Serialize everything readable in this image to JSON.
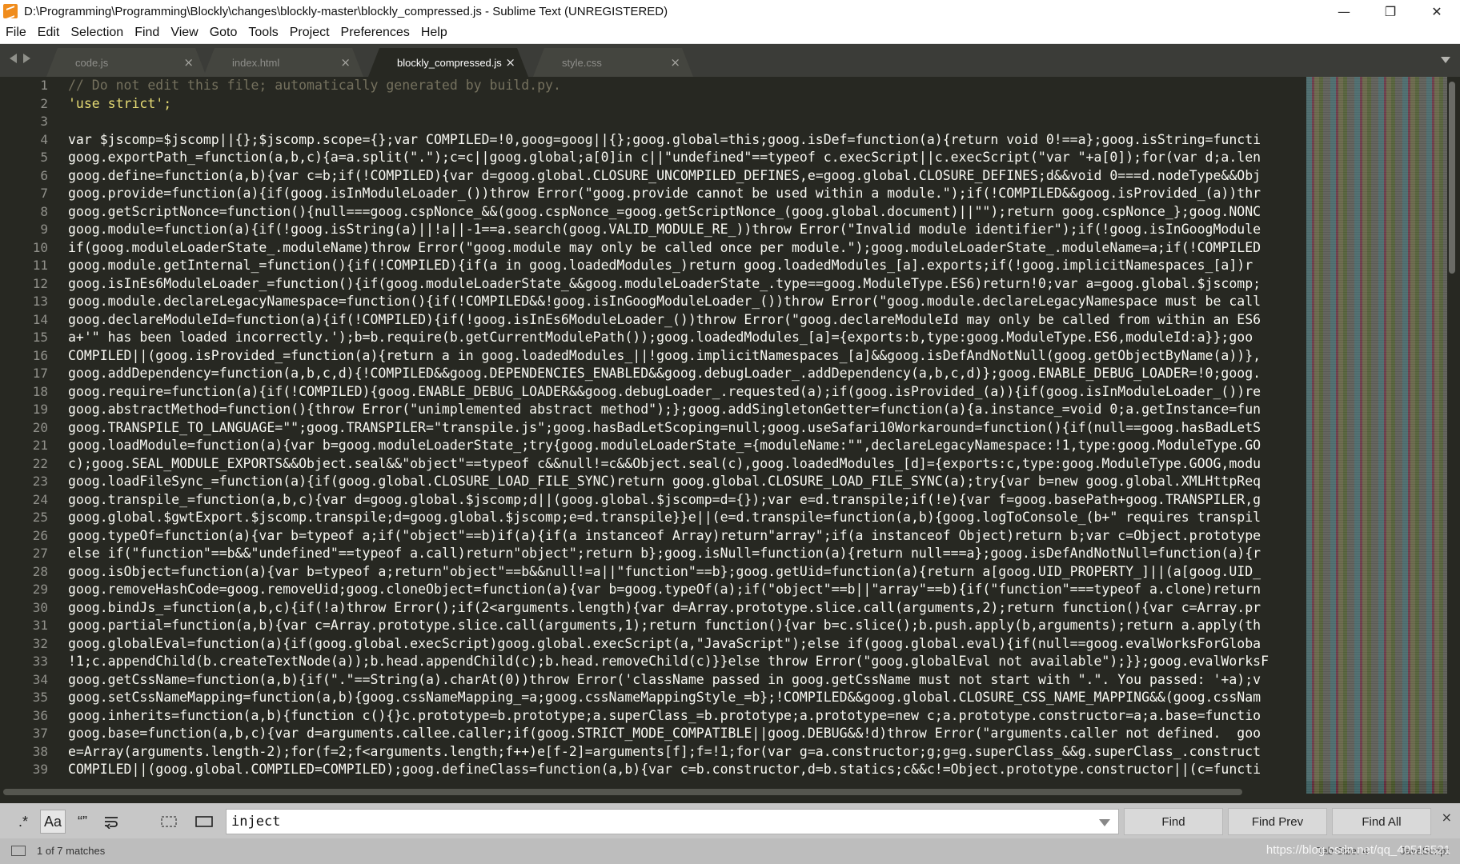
{
  "window": {
    "title": "D:\\Programming\\Programming\\Blockly\\changes\\blockly-master\\blockly_compressed.js - Sublime Text (UNREGISTERED)",
    "minimize_glyph": "—",
    "maximize_glyph": "❐",
    "close_glyph": "✕"
  },
  "menu": [
    "File",
    "Edit",
    "Selection",
    "Find",
    "View",
    "Goto",
    "Tools",
    "Project",
    "Preferences",
    "Help"
  ],
  "tabs": [
    {
      "label": "code.js",
      "active": false
    },
    {
      "label": "index.html",
      "active": false
    },
    {
      "label": "blockly_compressed.js",
      "active": true
    },
    {
      "label": "style.css",
      "active": false
    }
  ],
  "tab_close_glyph": "×",
  "editor": {
    "line_numbers": [
      "1",
      "2",
      "3",
      "4",
      "5",
      "6",
      "7",
      "8",
      "9",
      "10",
      "11",
      "12",
      "13",
      "14",
      "15",
      "16",
      "17",
      "18",
      "19",
      "20",
      "21",
      "22",
      "23",
      "24",
      "25",
      "26",
      "27",
      "28",
      "29",
      "30",
      "31",
      "32",
      "33",
      "34",
      "35",
      "36",
      "37",
      "38",
      "39"
    ],
    "lines": [
      "// Do not edit this file; automatically generated by build.py.",
      "'use strict';",
      "",
      "var $jscomp=$jscomp||{};$jscomp.scope={};var COMPILED=!0,goog=goog||{};goog.global=this;goog.isDef=function(a){return void 0!==a};goog.isString=functi",
      "goog.exportPath_=function(a,b,c){a=a.split(\".\");c=c||goog.global;a[0]in c||\"undefined\"==typeof c.execScript||c.execScript(\"var \"+a[0]);for(var d;a.len",
      "goog.define=function(a,b){var c=b;if(!COMPILED){var d=goog.global.CLOSURE_UNCOMPILED_DEFINES,e=goog.global.CLOSURE_DEFINES;d&&void 0===d.nodeType&&Obj",
      "goog.provide=function(a){if(goog.isInModuleLoader_())throw Error(\"goog.provide cannot be used within a module.\");if(!COMPILED&&goog.isProvided_(a))thr",
      "goog.getScriptNonce=function(){null===goog.cspNonce_&&(goog.cspNonce_=goog.getScriptNonce_(goog.global.document)||\"\");return goog.cspNonce_};goog.NONC",
      "goog.module=function(a){if(!goog.isString(a)||!a||-1==a.search(goog.VALID_MODULE_RE_))throw Error(\"Invalid module identifier\");if(!goog.isInGoogModule",
      "if(goog.moduleLoaderState_.moduleName)throw Error(\"goog.module may only be called once per module.\");goog.moduleLoaderState_.moduleName=a;if(!COMPILED",
      "goog.module.getInternal_=function(){if(!COMPILED){if(a in goog.loadedModules_)return goog.loadedModules_[a].exports;if(!goog.implicitNamespaces_[a])r",
      "goog.isInEs6ModuleLoader_=function(){if(goog.moduleLoaderState_&&goog.moduleLoaderState_.type==goog.ModuleType.ES6)return!0;var a=goog.global.$jscomp;",
      "goog.module.declareLegacyNamespace=function(){if(!COMPILED&&!goog.isInGoogModuleLoader_())throw Error(\"goog.module.declareLegacyNamespace must be call",
      "goog.declareModuleId=function(a){if(!COMPILED){if(!goog.isInEs6ModuleLoader_())throw Error(\"goog.declareModuleId may only be called from within an ES6",
      "a+'\" has been loaded incorrectly.');b=b.require(b.getCurrentModulePath());goog.loadedModules_[a]={exports:b,type:goog.ModuleType.ES6,moduleId:a}};goo",
      "COMPILED||(goog.isProvided_=function(a){return a in goog.loadedModules_||!goog.implicitNamespaces_[a]&&goog.isDefAndNotNull(goog.getObjectByName(a))},",
      "goog.addDependency=function(a,b,c,d){!COMPILED&&goog.DEPENDENCIES_ENABLED&&goog.debugLoader_.addDependency(a,b,c,d)};goog.ENABLE_DEBUG_LOADER=!0;goog.",
      "goog.require=function(a){if(!COMPILED){goog.ENABLE_DEBUG_LOADER&&goog.debugLoader_.requested(a);if(goog.isProvided_(a)){if(goog.isInModuleLoader_())re",
      "goog.abstractMethod=function(){throw Error(\"unimplemented abstract method\");};goog.addSingletonGetter=function(a){a.instance_=void 0;a.getInstance=fun",
      "goog.TRANSPILE_TO_LANGUAGE=\"\";goog.TRANSPILER=\"transpile.js\";goog.hasBadLetScoping=null;goog.useSafari10Workaround=function(){if(null==goog.hasBadLetS",
      "goog.loadModule=function(a){var b=goog.moduleLoaderState_;try{goog.moduleLoaderState_={moduleName:\"\",declareLegacyNamespace:!1,type:goog.ModuleType.GO",
      "c);goog.SEAL_MODULE_EXPORTS&&Object.seal&&\"object\"==typeof c&&null!=c&&Object.seal(c),goog.loadedModules_[d]={exports:c,type:goog.ModuleType.GOOG,modu",
      "goog.loadFileSync_=function(a){if(goog.global.CLOSURE_LOAD_FILE_SYNC)return goog.global.CLOSURE_LOAD_FILE_SYNC(a);try{var b=new goog.global.XMLHttpReq",
      "goog.transpile_=function(a,b,c){var d=goog.global.$jscomp;d||(goog.global.$jscomp=d={});var e=d.transpile;if(!e){var f=goog.basePath+goog.TRANSPILER,g",
      "goog.global.$gwtExport.$jscomp.transpile;d=goog.global.$jscomp;e=d.transpile}}e||(e=d.transpile=function(a,b){goog.logToConsole_(b+\" requires transpil",
      "goog.typeOf=function(a){var b=typeof a;if(\"object\"==b)if(a){if(a instanceof Array)return\"array\";if(a instanceof Object)return b;var c=Object.prototype",
      "else if(\"function\"==b&&\"undefined\"==typeof a.call)return\"object\";return b};goog.isNull=function(a){return null===a};goog.isDefAndNotNull=function(a){r",
      "goog.isObject=function(a){var b=typeof a;return\"object\"==b&&null!=a||\"function\"==b};goog.getUid=function(a){return a[goog.UID_PROPERTY_]||(a[goog.UID_",
      "goog.removeHashCode=goog.removeUid;goog.cloneObject=function(a){var b=goog.typeOf(a);if(\"object\"==b||\"array\"==b){if(\"function\"===typeof a.clone)return",
      "goog.bindJs_=function(a,b,c){if(!a)throw Error();if(2<arguments.length){var d=Array.prototype.slice.call(arguments,2);return function(){var c=Array.pr",
      "goog.partial=function(a,b){var c=Array.prototype.slice.call(arguments,1);return function(){var b=c.slice();b.push.apply(b,arguments);return a.apply(th",
      "goog.globalEval=function(a){if(goog.global.execScript)goog.global.execScript(a,\"JavaScript\");else if(goog.global.eval){if(null==goog.evalWorksForGloba",
      "!1;c.appendChild(b.createTextNode(a));b.head.appendChild(c);b.head.removeChild(c)}}else throw Error(\"goog.globalEval not available\");}};goog.evalWorksF",
      "goog.getCssName=function(a,b){if(\".\"==String(a).charAt(0))throw Error('className passed in goog.getCssName must not start with \".\". You passed: '+a);v",
      "goog.setCssNameMapping=function(a,b){goog.cssNameMapping_=a;goog.cssNameMappingStyle_=b};!COMPILED&&goog.global.CLOSURE_CSS_NAME_MAPPING&&(goog.cssNam",
      "goog.inherits=function(a,b){function c(){}c.prototype=b.prototype;a.superClass_=b.prototype;a.prototype=new c;a.prototype.constructor=a;a.base=functio",
      "goog.base=function(a,b,c){var d=arguments.callee.caller;if(goog.STRICT_MODE_COMPATIBLE||goog.DEBUG&&!d)throw Error(\"arguments.caller not defined.  goo",
      "e=Array(arguments.length-2);for(f=2;f<arguments.length;f++)e[f-2]=arguments[f];f=!1;for(var g=a.constructor;g;g=g.superClass_&&g.superClass_.construct",
      "COMPILED||(goog.global.COMPILED=COMPILED);goog.defineClass=function(a,b){var c=b.constructor,d=b.statics;c&&c!=Object.prototype.constructor||(c=functi"
    ]
  },
  "find": {
    "regex_label": ".*",
    "case_label": "Aa",
    "whole_word_label": "“”",
    "query": "inject",
    "find_label": "Find",
    "find_prev_label": "Find Prev",
    "find_all_label": "Find All",
    "close_glyph": "×"
  },
  "status": {
    "matches": "1 of 7 matches",
    "tab_size": "Tab Size: 4",
    "syntax": "JavaScript",
    "watermark": "https://blog.csdn.net/qq_40516521"
  }
}
